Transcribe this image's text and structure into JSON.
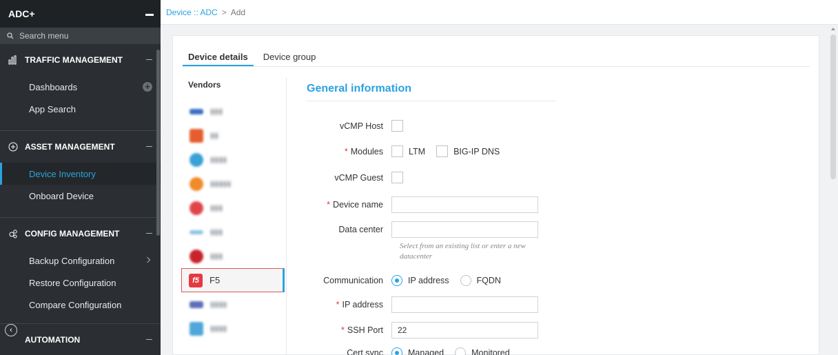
{
  "app": {
    "brand": "ADC+"
  },
  "sidebar": {
    "search_placeholder": "Search menu",
    "sections": [
      {
        "title": "TRAFFIC MANAGEMENT",
        "icon": "bar-chart-icon",
        "items": [
          {
            "label": "Dashboards"
          },
          {
            "label": "App Search"
          }
        ]
      },
      {
        "title": "ASSET MANAGEMENT",
        "icon": "plus-circle-icon",
        "items": [
          {
            "label": "Device Inventory",
            "active": true
          },
          {
            "label": "Onboard Device"
          }
        ]
      },
      {
        "title": "CONFIG MANAGEMENT",
        "icon": "gears-icon",
        "items": [
          {
            "label": "Backup Configuration"
          },
          {
            "label": "Restore Configuration"
          },
          {
            "label": "Compare Configuration"
          }
        ]
      },
      {
        "title": "AUTOMATION",
        "icon": "automation-icon",
        "items": []
      }
    ]
  },
  "breadcrumb": {
    "link": "Device :: ADC",
    "separator": ">",
    "current": "Add"
  },
  "tabs": [
    {
      "label": "Device details",
      "active": true
    },
    {
      "label": "Device group",
      "active": false
    }
  ],
  "vendors": {
    "title": "Vendors",
    "selected": "F5"
  },
  "form": {
    "section_title": "General information",
    "vcmp_host_label": "vCMP Host",
    "modules_label": "Modules",
    "module_ltm": "LTM",
    "module_bigip_dns": "BIG-IP DNS",
    "vcmp_guest_label": "vCMP Guest",
    "device_name_label": "Device name",
    "data_center_label": "Data center",
    "data_center_hint": "Select from an existing list or enter a new datacenter",
    "communication_label": "Communication",
    "comm_ip": "IP address",
    "comm_fqdn": "FQDN",
    "ip_address_label": "IP address",
    "ssh_port_label": "SSH Port",
    "ssh_port_value": "22",
    "cert_sync_label": "Cert sync",
    "cert_managed": "Managed",
    "cert_monitored": "Monitored"
  },
  "colors": {
    "accent": "#2ba2e0",
    "sidebar_bg": "#2b2f33",
    "required": "#e03a3a"
  }
}
